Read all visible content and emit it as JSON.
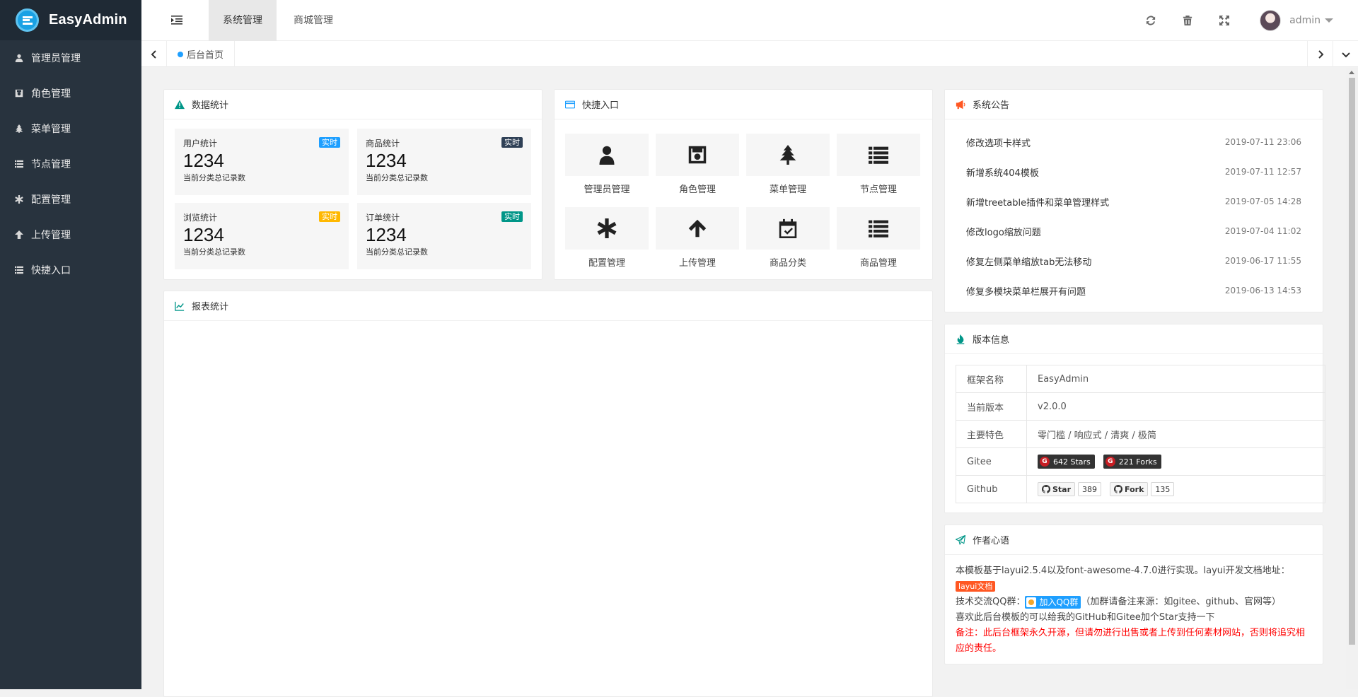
{
  "app": {
    "name": "EasyAdmin"
  },
  "sidebar": {
    "items": [
      {
        "label": "管理员管理",
        "icon": "user-icon"
      },
      {
        "label": "角色管理",
        "icon": "save-icon"
      },
      {
        "label": "菜单管理",
        "icon": "tree-icon"
      },
      {
        "label": "节点管理",
        "icon": "list-icon"
      },
      {
        "label": "配置管理",
        "icon": "asterisk-icon"
      },
      {
        "label": "上传管理",
        "icon": "arrow-up-icon"
      },
      {
        "label": "快捷入口",
        "icon": "list-icon"
      }
    ]
  },
  "header": {
    "tabs": [
      {
        "label": "系统管理"
      },
      {
        "label": "商城管理"
      }
    ],
    "user": "admin"
  },
  "tabbar": {
    "home": "后台首页"
  },
  "stats": {
    "title": "数据统计",
    "items": [
      {
        "title": "用户统计",
        "value": "1234",
        "desc": "当前分类总记录数",
        "badge": "实时",
        "badge_color": "#1e9fff"
      },
      {
        "title": "商品统计",
        "value": "1234",
        "desc": "当前分类总记录数",
        "badge": "实时",
        "badge_color": "#2f4056"
      },
      {
        "title": "浏览统计",
        "value": "1234",
        "desc": "当前分类总记录数",
        "badge": "实时",
        "badge_color": "#ffb800"
      },
      {
        "title": "订单统计",
        "value": "1234",
        "desc": "当前分类总记录数",
        "badge": "实时",
        "badge_color": "#009688"
      }
    ]
  },
  "quick": {
    "title": "快捷入口",
    "items": [
      {
        "label": "管理员管理",
        "icon": "user-icon"
      },
      {
        "label": "角色管理",
        "icon": "save-icon"
      },
      {
        "label": "菜单管理",
        "icon": "tree-icon"
      },
      {
        "label": "节点管理",
        "icon": "list-icon"
      },
      {
        "label": "配置管理",
        "icon": "asterisk-icon"
      },
      {
        "label": "上传管理",
        "icon": "arrow-up-icon"
      },
      {
        "label": "商品分类",
        "icon": "calendar-check-icon"
      },
      {
        "label": "商品管理",
        "icon": "list-icon"
      }
    ]
  },
  "report": {
    "title": "报表统计"
  },
  "notices": {
    "title": "系统公告",
    "items": [
      {
        "title": "修改选项卡样式",
        "time": "2019-07-11 23:06"
      },
      {
        "title": "新增系统404模板",
        "time": "2019-07-11 12:57"
      },
      {
        "title": "新增treetable插件和菜单管理样式",
        "time": "2019-07-05 14:28"
      },
      {
        "title": "修改logo缩放问题",
        "time": "2019-07-04 11:02"
      },
      {
        "title": "修复左侧菜单缩放tab无法移动",
        "time": "2019-06-17 11:55"
      },
      {
        "title": "修复多模块菜单栏展开有问题",
        "time": "2019-06-13 14:53"
      }
    ]
  },
  "version": {
    "title": "版本信息",
    "rows": [
      {
        "key": "框架名称",
        "value": "EasyAdmin"
      },
      {
        "key": "当前版本",
        "value": "v2.0.0"
      },
      {
        "key": "主要特色",
        "value": "零门槛 / 响应式 / 清爽 / 极简"
      }
    ],
    "gitee": {
      "key": "Gitee",
      "stars": "642 Stars",
      "forks": "221 Forks"
    },
    "github": {
      "key": "Github",
      "star_label": "Star",
      "star_count": "389",
      "fork_label": "Fork",
      "fork_count": "135"
    }
  },
  "author": {
    "title": "作者心语",
    "line1": "本模板基于layui2.5.4以及font-awesome-4.7.0进行实现。layui开发文档地址：",
    "doc_tag": "layui文档",
    "qq_prefix": "技术交流QQ群：",
    "qq_button": "加入QQ群",
    "qq_suffix": "（加群请备注来源：如gitee、github、官网等）",
    "line3": "喜欢此后台模板的可以给我的GitHub和Gitee加个Star支持一下",
    "note": "备注：此后台框架永久开源，但请勿进行出售或者上传到任何素材网站，否则将追究相应的责任。"
  },
  "colors": {
    "sidebar_bg": "#28333e",
    "logo_bg": "#1f2a35",
    "accent_blue": "#1e9fff",
    "accent_green": "#009688",
    "accent_red": "#ff5722"
  }
}
